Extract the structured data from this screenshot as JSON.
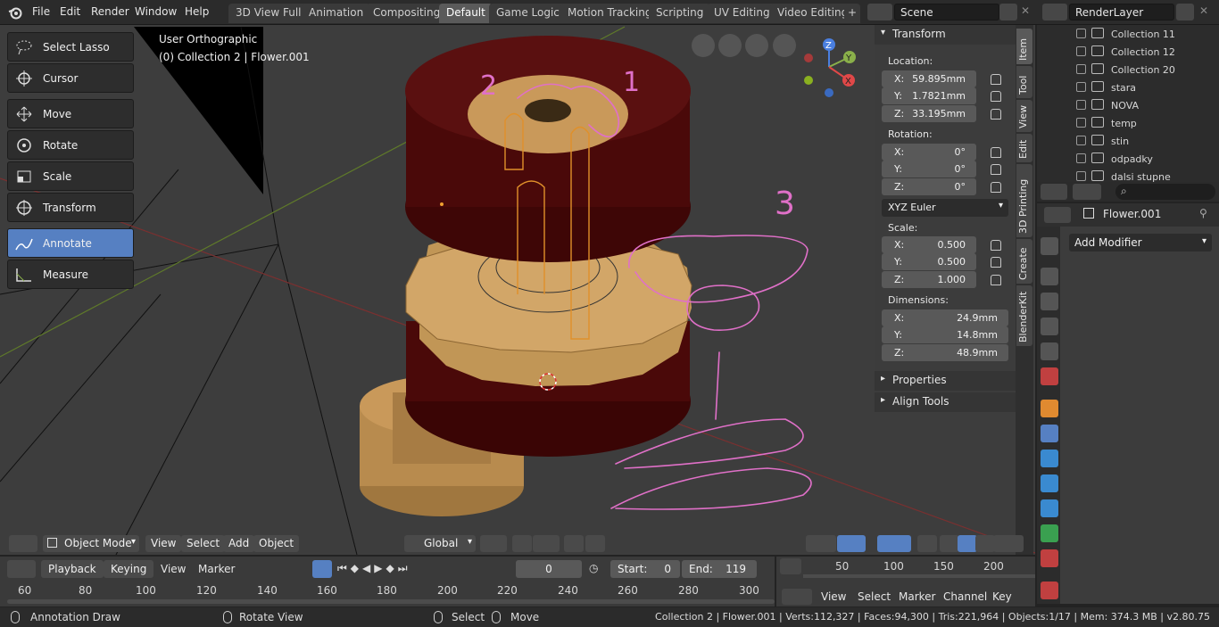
{
  "topbar": {
    "menus": [
      "File",
      "Edit",
      "Render",
      "Window",
      "Help"
    ],
    "workspaces": [
      "3D View Full",
      "Animation",
      "Compositing",
      "Default",
      "Game Logic",
      "Motion Tracking",
      "Scripting",
      "UV Editing",
      "Video Editing"
    ],
    "active_workspace": "Default",
    "add_tab": "+",
    "scene": "Scene",
    "render_layer": "RenderLayer"
  },
  "viewport": {
    "view_name": "User Orthographic",
    "object_info": "(0) Collection 2 | Flower.001",
    "annotation_numbers": [
      "2",
      "1",
      "3",
      "1"
    ]
  },
  "toolbar": {
    "tools": [
      {
        "label": "Select Lasso",
        "icon": "lasso-icon"
      },
      {
        "label": "Cursor",
        "icon": "cursor-icon"
      },
      {
        "label": "Move",
        "icon": "move-icon"
      },
      {
        "label": "Rotate",
        "icon": "rotate-icon"
      },
      {
        "label": "Scale",
        "icon": "scale-icon"
      },
      {
        "label": "Transform",
        "icon": "transform-icon"
      },
      {
        "label": "Annotate",
        "icon": "annotate-icon"
      },
      {
        "label": "Measure",
        "icon": "measure-icon"
      }
    ],
    "active_tool": "Annotate"
  },
  "npanel": {
    "transform_title": "Transform",
    "location_label": "Location:",
    "location": [
      {
        "axis": "X:",
        "value": "59.895mm"
      },
      {
        "axis": "Y:",
        "value": "1.7821mm"
      },
      {
        "axis": "Z:",
        "value": "33.195mm"
      }
    ],
    "rotation_label": "Rotation:",
    "rotation": [
      {
        "axis": "X:",
        "value": "0°"
      },
      {
        "axis": "Y:",
        "value": "0°"
      },
      {
        "axis": "Z:",
        "value": "0°"
      }
    ],
    "rotation_mode": "XYZ Euler",
    "scale_label": "Scale:",
    "scale": [
      {
        "axis": "X:",
        "value": "0.500"
      },
      {
        "axis": "Y:",
        "value": "0.500"
      },
      {
        "axis": "Z:",
        "value": "1.000"
      }
    ],
    "dimensions_label": "Dimensions:",
    "dimensions": [
      {
        "axis": "X:",
        "value": "24.9mm"
      },
      {
        "axis": "Y:",
        "value": "14.8mm"
      },
      {
        "axis": "Z:",
        "value": "48.9mm"
      }
    ],
    "properties_title": "Properties",
    "align_tools_title": "Align Tools",
    "tabs": [
      "Item",
      "Tool",
      "View",
      "Edit",
      "3D Printing",
      "Create",
      "BlenderKit"
    ],
    "active_tab": "Item"
  },
  "viewport_header": {
    "mode": "Object Mode",
    "menus": [
      "View",
      "Select",
      "Add",
      "Object"
    ],
    "orientation": "Global"
  },
  "outliner": {
    "items": [
      "Collection 11",
      "Collection 12",
      "Collection 20",
      "stara",
      "NOVA",
      "temp",
      "stin",
      "odpadky",
      "dalsi stupne"
    ]
  },
  "properties": {
    "object_name": "Flower.001",
    "add_modifier": "Add Modifier"
  },
  "timeline": {
    "menus": [
      "Playback",
      "Keying",
      "View",
      "Marker"
    ],
    "current_frame": "0",
    "start_label": "Start:",
    "start": "0",
    "end_label": "End:",
    "end": "119",
    "ruler": [
      "60",
      "80",
      "100",
      "120",
      "140",
      "160",
      "180",
      "200",
      "220",
      "240",
      "260",
      "280",
      "300"
    ]
  },
  "graph": {
    "ruler": [
      "50",
      "100",
      "150",
      "200"
    ],
    "menus": [
      "View",
      "Select",
      "Marker",
      "Channel",
      "Key"
    ]
  },
  "statusbar": {
    "left_action": "Annotation Draw",
    "middle_action": "Rotate View",
    "right_click": "Select",
    "right_action": "Move",
    "stats": "Collection 2 | Flower.001 | Verts:112,327 | Faces:94,300 | Tris:221,964 | Objects:1/17 | Mem: 374.3 MB | v2.80.75"
  }
}
